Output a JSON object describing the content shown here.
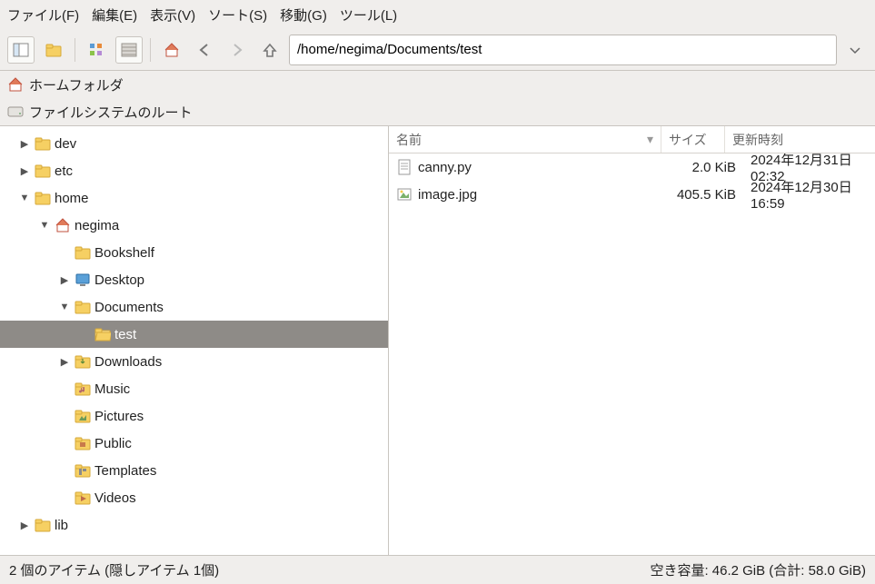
{
  "menu": {
    "file": "ファイル(F)",
    "edit": "編集(E)",
    "view": "表示(V)",
    "sort": "ソート(S)",
    "go": "移動(G)",
    "tools": "ツール(L)"
  },
  "toolbar": {
    "path": "/home/negima/Documents/test"
  },
  "places": {
    "home": "ホームフォルダ",
    "root": "ファイルシステムのルート"
  },
  "tree": {
    "dev": "dev",
    "etc": "etc",
    "home": "home",
    "negima": "negima",
    "bookshelf": "Bookshelf",
    "desktop": "Desktop",
    "documents": "Documents",
    "test": "test",
    "downloads": "Downloads",
    "music": "Music",
    "pictures": "Pictures",
    "public": "Public",
    "templates": "Templates",
    "videos": "Videos",
    "lib": "lib"
  },
  "columns": {
    "name": "名前",
    "size": "サイズ",
    "modified": "更新時刻"
  },
  "files": [
    {
      "name": "canny.py",
      "size": "2.0 KiB",
      "date": "2024年12月31日 02:32",
      "icon": "text"
    },
    {
      "name": "image.jpg",
      "size": "405.5 KiB",
      "date": "2024年12月30日 16:59",
      "icon": "image"
    }
  ],
  "status": {
    "left": "2 個のアイテム (隠しアイテム 1個)",
    "right": "空き容量: 46.2 GiB (合計: 58.0 GiB)"
  }
}
